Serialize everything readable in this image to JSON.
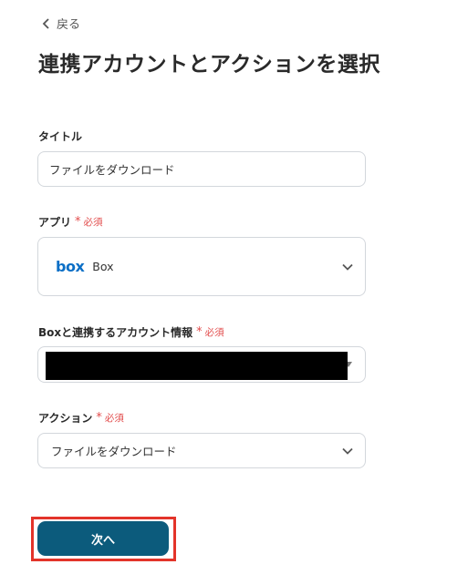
{
  "back": {
    "label": "戻る"
  },
  "page_title": "連携アカウントとアクションを選択",
  "required_label": "必須",
  "form": {
    "title_field": {
      "label": "タイトル",
      "value": "ファイルをダウンロード"
    },
    "app_field": {
      "label": "アプリ",
      "selected_app": "Box",
      "logo_text": "box",
      "logo_color": "#0b6fc6"
    },
    "account_field": {
      "label": "Boxと連携するアカウント情報"
    },
    "action_field": {
      "label": "アクション",
      "selected": "ファイルをダウンロード"
    }
  },
  "next_button": {
    "label": "次へ",
    "color": "#0c5b7c",
    "highlight_color": "#e3342a"
  }
}
